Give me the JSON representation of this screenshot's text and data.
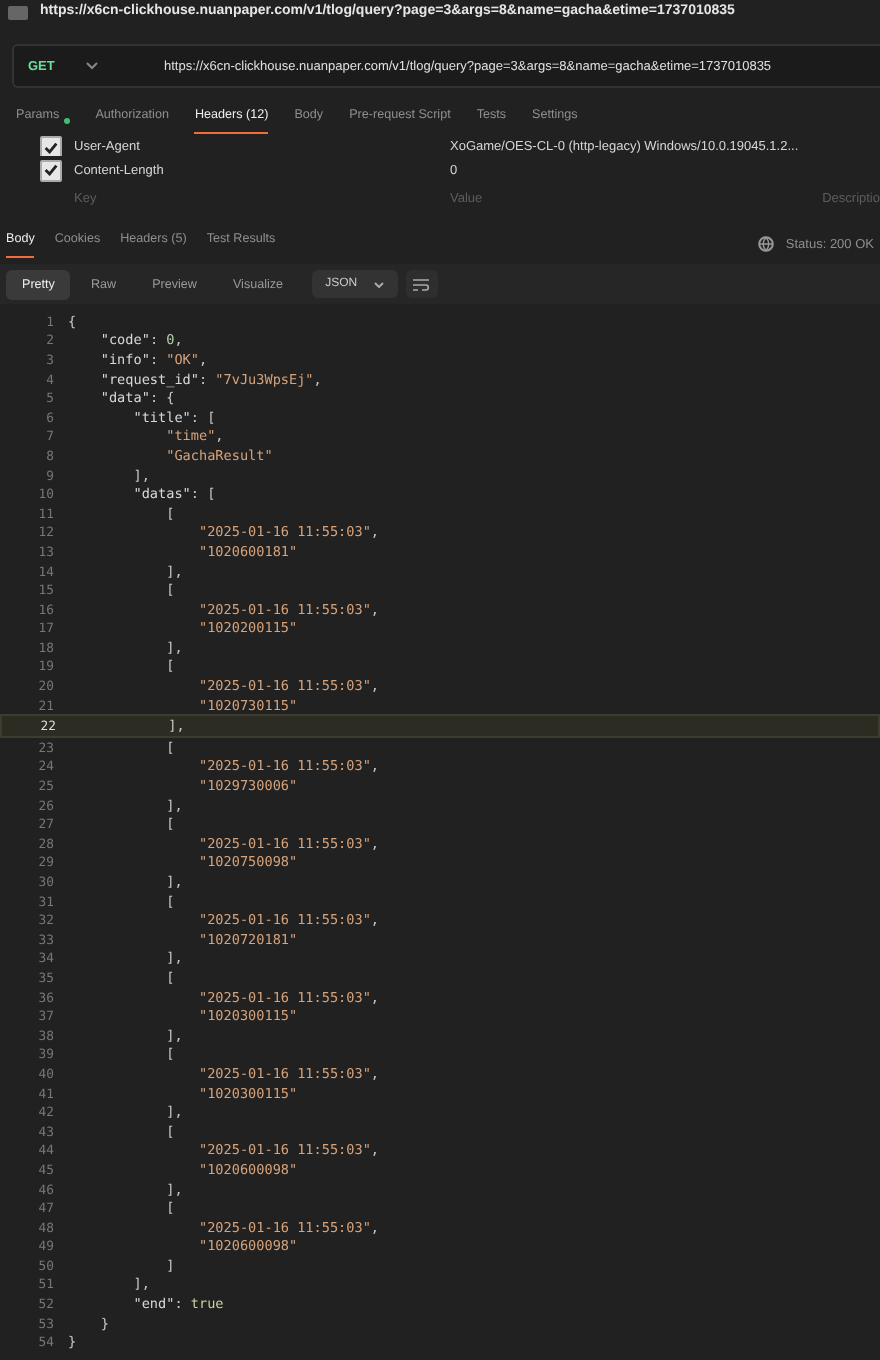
{
  "window": {
    "title": "https://x6cn-clickhouse.nuanpaper.com/v1/tlog/query?page=3&args=8&name=gacha&etime=1737010835"
  },
  "request": {
    "method": "GET",
    "url": "https://x6cn-clickhouse.nuanpaper.com/v1/tlog/query?page=3&args=8&name=gacha&etime=1737010835"
  },
  "request_tabs": [
    {
      "label": "Params",
      "dot": true,
      "selected": false
    },
    {
      "label": "Authorization",
      "selected": false
    },
    {
      "label": "Headers (12)",
      "selected": true
    },
    {
      "label": "Body",
      "selected": false
    },
    {
      "label": "Pre-request Script",
      "selected": false
    },
    {
      "label": "Tests",
      "selected": false
    },
    {
      "label": "Settings",
      "selected": false
    }
  ],
  "headers": {
    "rows": [
      {
        "key": "User-Agent",
        "value": "XoGame/OES-CL-0 (http-legacy) Windows/10.0.19045.1.2...",
        "checked": true
      },
      {
        "key": "Content-Length",
        "value": "0",
        "checked": true
      }
    ],
    "placeholders": {
      "key": "Key",
      "value": "Value",
      "description": "Descriptio"
    }
  },
  "response_tabs": [
    {
      "label": "Body",
      "selected": true
    },
    {
      "label": "Cookies",
      "selected": false
    },
    {
      "label": "Headers (5)",
      "selected": false
    },
    {
      "label": "Test Results",
      "selected": false
    }
  ],
  "status": "Status: 200 OK",
  "view_modes": [
    {
      "label": "Pretty",
      "selected": true
    },
    {
      "label": "Raw",
      "selected": false
    },
    {
      "label": "Preview",
      "selected": false
    },
    {
      "label": "Visualize",
      "selected": false
    }
  ],
  "format": "JSON",
  "code_lines": [
    {
      "number": "1",
      "code": "{",
      "selected": false
    },
    {
      "number": "2",
      "code": "    \"code\": 0,",
      "selected": false
    },
    {
      "number": "3",
      "code": "    \"info\": \"OK\",",
      "selected": false
    },
    {
      "number": "4",
      "code": "    \"request_id\": \"7vJu3WpsEj\",",
      "selected": false
    },
    {
      "number": "5",
      "code": "    \"data\": {",
      "selected": false
    },
    {
      "number": "6",
      "code": "        \"title\": [",
      "selected": false
    },
    {
      "number": "7",
      "code": "            \"time\",",
      "selected": false
    },
    {
      "number": "8",
      "code": "            \"GachaResult\"",
      "selected": false
    },
    {
      "number": "9",
      "code": "        ],",
      "selected": false
    },
    {
      "number": "10",
      "code": "        \"datas\": [",
      "selected": false
    },
    {
      "number": "11",
      "code": "            [",
      "selected": false
    },
    {
      "number": "12",
      "code": "                \"2025-01-16 11:55:03\",",
      "selected": false
    },
    {
      "number": "13",
      "code": "                \"1020600181\"",
      "selected": false
    },
    {
      "number": "14",
      "code": "            ],",
      "selected": false
    },
    {
      "number": "15",
      "code": "            [",
      "selected": false
    },
    {
      "number": "16",
      "code": "                \"2025-01-16 11:55:03\",",
      "selected": false
    },
    {
      "number": "17",
      "code": "                \"1020200115\"",
      "selected": false
    },
    {
      "number": "18",
      "code": "            ],",
      "selected": false
    },
    {
      "number": "19",
      "code": "            [",
      "selected": false
    },
    {
      "number": "20",
      "code": "                \"2025-01-16 11:55:03\",",
      "selected": false
    },
    {
      "number": "21",
      "code": "                \"1020730115\"",
      "selected": false
    },
    {
      "number": "22",
      "code": "            ],",
      "selected": true
    },
    {
      "number": "23",
      "code": "            [",
      "selected": false
    },
    {
      "number": "24",
      "code": "                \"2025-01-16 11:55:03\",",
      "selected": false
    },
    {
      "number": "25",
      "code": "                \"1029730006\"",
      "selected": false
    },
    {
      "number": "26",
      "code": "            ],",
      "selected": false
    },
    {
      "number": "27",
      "code": "            [",
      "selected": false
    },
    {
      "number": "28",
      "code": "                \"2025-01-16 11:55:03\",",
      "selected": false
    },
    {
      "number": "29",
      "code": "                \"1020750098\"",
      "selected": false
    },
    {
      "number": "30",
      "code": "            ],",
      "selected": false
    },
    {
      "number": "31",
      "code": "            [",
      "selected": false
    },
    {
      "number": "32",
      "code": "                \"2025-01-16 11:55:03\",",
      "selected": false
    },
    {
      "number": "33",
      "code": "                \"1020720181\"",
      "selected": false
    },
    {
      "number": "34",
      "code": "            ],",
      "selected": false
    },
    {
      "number": "35",
      "code": "            [",
      "selected": false
    },
    {
      "number": "36",
      "code": "                \"2025-01-16 11:55:03\",",
      "selected": false
    },
    {
      "number": "37",
      "code": "                \"1020300115\"",
      "selected": false
    },
    {
      "number": "38",
      "code": "            ],",
      "selected": false
    },
    {
      "number": "39",
      "code": "            [",
      "selected": false
    },
    {
      "number": "40",
      "code": "                \"2025-01-16 11:55:03\",",
      "selected": false
    },
    {
      "number": "41",
      "code": "                \"1020300115\"",
      "selected": false
    },
    {
      "number": "42",
      "code": "            ],",
      "selected": false
    },
    {
      "number": "43",
      "code": "            [",
      "selected": false
    },
    {
      "number": "44",
      "code": "                \"2025-01-16 11:55:03\",",
      "selected": false
    },
    {
      "number": "45",
      "code": "                \"1020600098\"",
      "selected": false
    },
    {
      "number": "46",
      "code": "            ],",
      "selected": false
    },
    {
      "number": "47",
      "code": "            [",
      "selected": false
    },
    {
      "number": "48",
      "code": "                \"2025-01-16 11:55:03\",",
      "selected": false
    },
    {
      "number": "49",
      "code": "                \"1020600098\"",
      "selected": false
    },
    {
      "number": "50",
      "code": "            ]",
      "selected": false
    },
    {
      "number": "51",
      "code": "        ],",
      "selected": false
    },
    {
      "number": "52",
      "code": "        \"end\": true",
      "selected": false
    },
    {
      "number": "53",
      "code": "    }",
      "selected": false
    },
    {
      "number": "54",
      "code": "}",
      "selected": false
    }
  ]
}
